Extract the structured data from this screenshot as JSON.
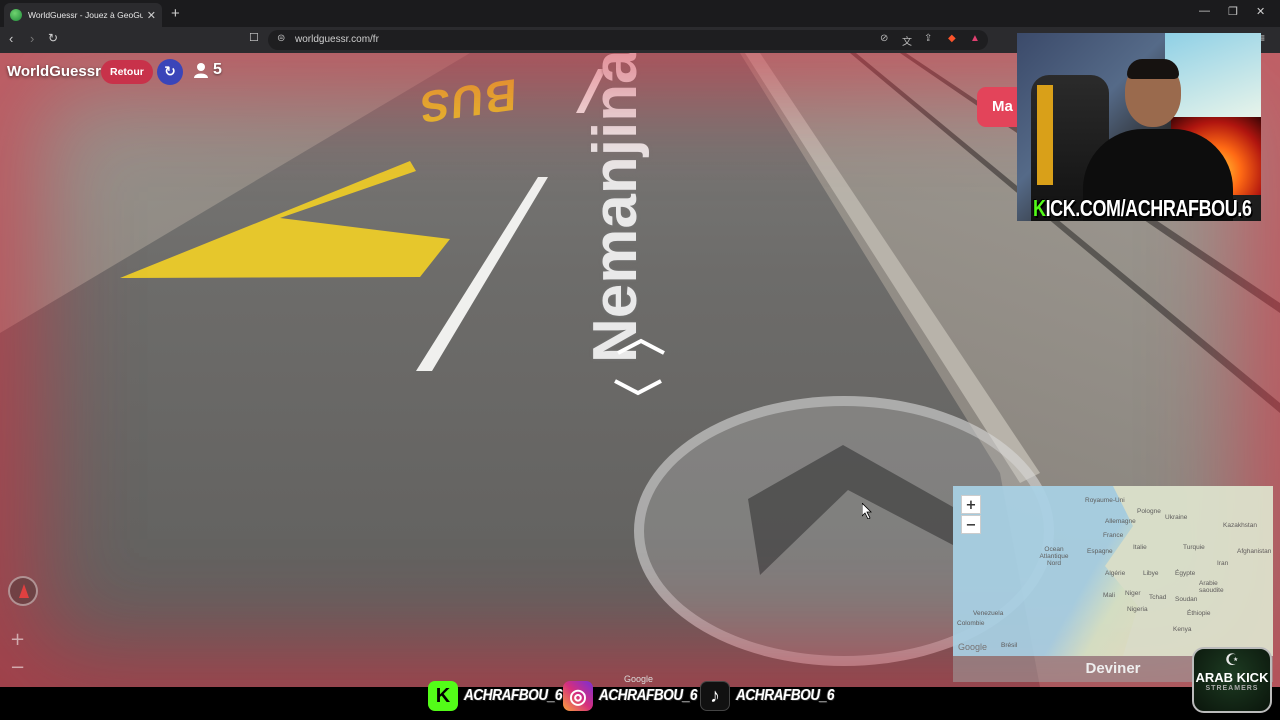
{
  "browser": {
    "tab_title": "WorldGuessr - Jouez à GeoGuessr",
    "tab_close": "✕",
    "new_tab": "+",
    "url": "worldguessr.com/fr",
    "window": {
      "minimize": "—",
      "restore": "❐",
      "close": "✕"
    }
  },
  "game": {
    "brand": "WorldGuessr",
    "back_label": "Retour",
    "refresh_icon": "↻",
    "players_count": "5",
    "map_button_label": "Ma",
    "zoom_in": "+",
    "zoom_out": "−",
    "guess_label": "Deviner"
  },
  "scene": {
    "road_text": "BUS",
    "street_name": "Nemanjina",
    "credit": "Google"
  },
  "minimap": {
    "zoom_in": "+",
    "zoom_out": "−",
    "labels": {
      "royaume_uni": "Royaume-Uni",
      "pologne": "Pologne",
      "allemagne": "Allemagne",
      "ukraine": "Ukraine",
      "kazakhstan": "Kazakhstan",
      "france": "France",
      "espagne": "Espagne",
      "italie": "Italie",
      "turquie": "Turquie",
      "ocean": "Ocean\nAtlantique\nNord",
      "algerie": "Algérie",
      "libye": "Libye",
      "egypte": "Égypte",
      "iran": "Iran",
      "afghanistan": "Afghanistan",
      "arabie": "Arabie\nsaoudite",
      "mali": "Mali",
      "niger": "Niger",
      "tchad": "Tchad",
      "soudan": "Soudan",
      "nigeria": "Nigeria",
      "ethiopie": "Éthiopie",
      "venezuela": "Venezuela",
      "colombie": "Colombie",
      "bresil": "Brésil",
      "kenya": "Kenya",
      "google": "Google"
    }
  },
  "stream": {
    "kick_url_k": "K",
    "kick_url_rest": "ICK.COM/ACHRAFBOU.6",
    "socials": [
      {
        "icon": "K",
        "label": "ACHRAFBOU_6",
        "color": "#53fc18"
      },
      {
        "icon": "◎",
        "label": "ACHRAFBOU_6",
        "color": "#d62f7c"
      },
      {
        "icon": "♪",
        "label": "ACHRAFBOU_6",
        "color": "#111111"
      }
    ],
    "badge_top": "☪",
    "badge_title": "ARAB KICK",
    "badge_subtitle": "STREAMERS"
  }
}
